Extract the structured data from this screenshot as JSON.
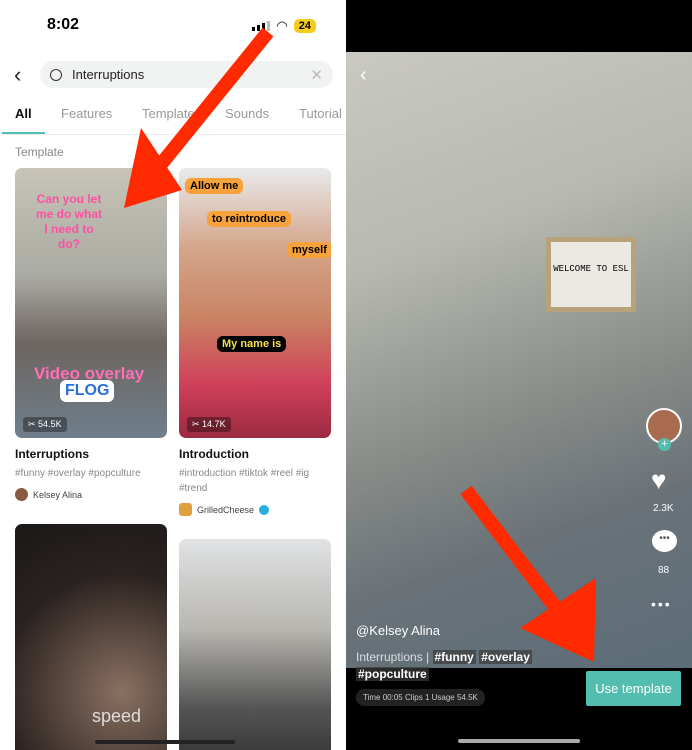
{
  "left": {
    "status": {
      "time": "8:02",
      "battery": "24"
    },
    "search": {
      "value": "Interruptions"
    },
    "tabs": [
      "All",
      "Features",
      "Templates",
      "Sounds",
      "Tutorial"
    ],
    "section": "Template",
    "cards": [
      {
        "title": "Interruptions",
        "tags": "#funny #overlay #popculture",
        "author": "Kelsey Alina",
        "uses": "54.5K",
        "captions": [
          "Can you let me do what I need to do?",
          "Video overlay",
          "FLOG"
        ]
      },
      {
        "title": "Introduction",
        "tags": "#introduction #tiktok #reel #ig #trend",
        "author": "GrilledCheese",
        "uses": "14.7K",
        "captions": [
          "Allow me",
          "to reintroduce",
          "myself",
          "My name is"
        ]
      },
      {
        "overlay": "speed"
      }
    ]
  },
  "right": {
    "sign": "WELCOME TO ESL",
    "likes": "2.3K",
    "comments": "88",
    "author": "@Kelsey Alina",
    "title": "Interruptions |",
    "tags": [
      "#funny",
      "#overlay",
      "#popculture"
    ],
    "info": "Time 00:05 Clips 1 Usage 54.5K",
    "use_button": "Use template"
  },
  "colors": {
    "accent": "#53bdb0",
    "arrow": "#ff2a00"
  }
}
